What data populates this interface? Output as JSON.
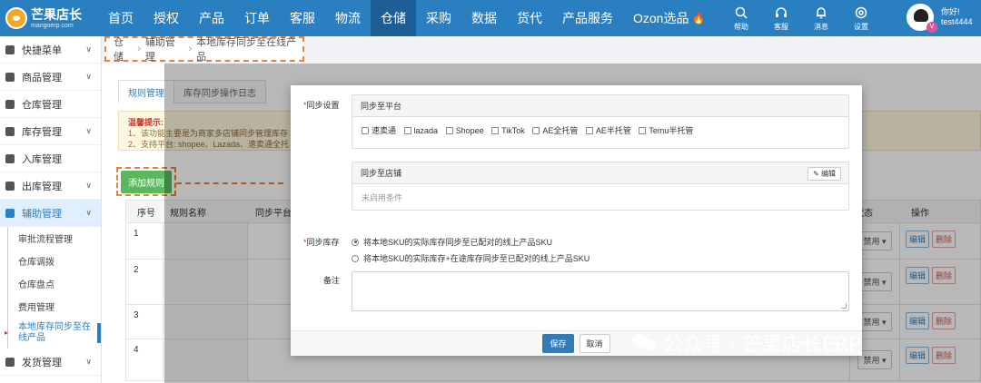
{
  "logo": {
    "name": "芒果店长",
    "domain": "mangoerp.com"
  },
  "nav": [
    "首页",
    "授权",
    "产品",
    "订单",
    "客服",
    "物流",
    "仓储",
    "采购",
    "数据",
    "货代",
    "产品服务",
    "Ozon选品"
  ],
  "nav_active": "仓储",
  "tools": [
    {
      "label": "帮助",
      "icon": "search-icon"
    },
    {
      "label": "客服",
      "icon": "headset-icon"
    },
    {
      "label": "消息",
      "icon": "bell-icon"
    },
    {
      "label": "设置",
      "icon": "gear-icon"
    }
  ],
  "user": {
    "greeting": "你好!",
    "name": "test4444",
    "badge": "V"
  },
  "sidebar": {
    "items": [
      {
        "label": "快捷菜单",
        "icon": "gear-icon"
      },
      {
        "label": "商品管理",
        "icon": "box-icon"
      },
      {
        "label": "仓库管理",
        "icon": "warehouse-icon"
      },
      {
        "label": "库存管理",
        "icon": "list-icon"
      },
      {
        "label": "入库管理",
        "icon": "inbound-icon"
      },
      {
        "label": "出库管理",
        "icon": "outbound-icon"
      },
      {
        "label": "辅助管理",
        "icon": "tool-icon"
      }
    ],
    "subs": [
      "审批流程管理",
      "仓库调拨",
      "仓库盘点",
      "费用管理",
      "本地库存同步至在线产品"
    ],
    "last": {
      "label": "发货管理",
      "icon": "ship-icon"
    }
  },
  "breadcrumb": [
    "仓储",
    "辅助管理",
    "本地库存同步至在线产品"
  ],
  "tabs": [
    "规则管理",
    "库存同步操作日志"
  ],
  "tip": {
    "title": "温馨提示:",
    "line1": "1、该功能主要是为商家多店铺同步管理库存",
    "line2": "2、支持平台: shopee、Lazada、速卖通全托"
  },
  "add_rule": "添加规则",
  "table": {
    "headers": [
      "序号",
      "规则名称",
      "同步平台",
      "状态",
      "操作"
    ],
    "rows": [
      "1",
      "2",
      "3",
      "4"
    ],
    "status_value": "禁用",
    "edit": "编辑",
    "delete": "删除"
  },
  "modal": {
    "sync_setting_label": "同步设置",
    "platform_panel_title": "同步至平台",
    "platforms": [
      "速卖通",
      "lazada",
      "Shopee",
      "TikTok",
      "AE全托管",
      "AE半托管",
      "Temu半托管"
    ],
    "shop_panel_title": "同步至店铺",
    "shop_edit": "编辑",
    "shop_empty": "未启用条件",
    "sync_stock_label": "同步库存",
    "options": [
      "将本地SKU的实际库存同步至已配对的线上产品SKU",
      "将本地SKU的实际库存+在途库存同步至已配对的线上产品SKU"
    ],
    "note_label": "备注",
    "save": "保存",
    "cancel": "取消"
  },
  "watermark": "公众号 · 芒果店长ERP"
}
